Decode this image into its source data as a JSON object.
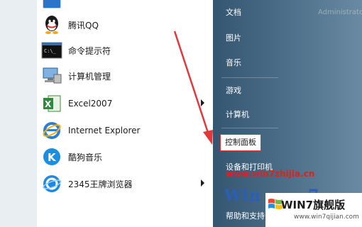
{
  "programs": [
    {
      "label": "腾讯QQ",
      "icon": "qq-icon",
      "has_submenu": false
    },
    {
      "label": "命令提示符",
      "icon": "command-prompt-icon",
      "has_submenu": false
    },
    {
      "label": "计算机管理",
      "icon": "computer-management-icon",
      "has_submenu": false
    },
    {
      "label": "Excel2007",
      "icon": "excel-icon",
      "has_submenu": true
    },
    {
      "label": "Internet Explorer",
      "icon": "internet-explorer-icon",
      "has_submenu": false
    },
    {
      "label": "酷狗音乐",
      "icon": "kugou-icon",
      "has_submenu": false
    },
    {
      "label": "2345王牌浏览器",
      "icon": "browser-2345-icon",
      "has_submenu": true
    }
  ],
  "right_menu": [
    {
      "label": "文档"
    },
    {
      "label": "图片"
    },
    {
      "label": "音乐"
    },
    {
      "label": "游戏"
    },
    {
      "label": "计算机"
    },
    {
      "label": "控制面板",
      "highlight": true
    },
    {
      "label": "设备和打印机"
    }
  ],
  "help_item": "帮助和支持",
  "faint_texts": [
    "Administrator"
  ],
  "watermark": {
    "url": "www.win7zhijia.cn",
    "badge_title": "WIN7旗舰版",
    "badge_url": "www.win7qijian.com"
  },
  "colors": {
    "highlight_border": "#e0383b",
    "arrow": "#e0383b",
    "watermark_red": "#d8241f"
  }
}
